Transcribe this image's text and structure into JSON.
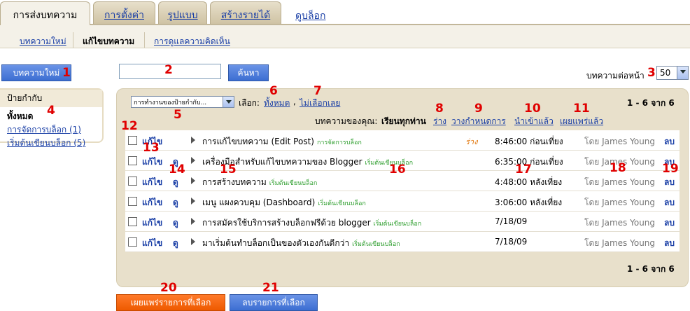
{
  "tabs": [
    {
      "label": "การส่งบทความ",
      "active": true
    },
    {
      "label": "การตั้งค่า",
      "active": false
    },
    {
      "label": "รูปแบบ",
      "active": false
    },
    {
      "label": "สร้างรายได้",
      "active": false
    },
    {
      "label": "ดูบล็อก",
      "active": false
    }
  ],
  "subtabs": [
    {
      "label": "บทความใหม่",
      "active": false
    },
    {
      "label": "แก้ไขบทความ",
      "active": true
    },
    {
      "label": "การดูแลความคิดเห็น",
      "active": false
    }
  ],
  "new_post_button": "บทความใหม่",
  "search": {
    "value": "",
    "button": "ค้นหา"
  },
  "per_page": {
    "label": "บทความต่อหน้า",
    "value": "50"
  },
  "labels_panel": {
    "header": "ป้ายกำกับ",
    "all": "ทั้งหมด",
    "items": [
      "การจัดการบล็อก (1)",
      "เริ่มต้นเขียนบล็อก (5)"
    ]
  },
  "toolbar": {
    "label_action": "การทำงานของป้ายกำกับ...",
    "select_prefix": "เลือก:",
    "select_all": "ทั้งหมด",
    "select_none": "ไม่เลือกเลย",
    "comma": ",",
    "range": "1 - 6 จาก 6",
    "filter_prefix": "บทความของคุณ:",
    "filter_all": "เรียนทุกท่าน",
    "filter_draft": "ร่าง",
    "filter_scheduled": "วางกำหนดการ",
    "filter_imported": "นำเข้าแล้ว",
    "filter_published": "เผยแพร่แล้ว"
  },
  "posts": [
    {
      "edit": "แก้ไข",
      "view": "",
      "title": "การแก้ไขบทความ (Edit Post)",
      "label": "การจัดการบล็อก",
      "status": "ร่าง",
      "time": "8:46:00 ก่อนเที่ยง",
      "author": "โดย James Young",
      "delete": "ลบ"
    },
    {
      "edit": "แก้ไข",
      "view": "ดู",
      "title": "เครื่องมือสำหรับแก้ไขบทความของ Blogger",
      "label": "เริ่มต้นเขียนบล็อก",
      "status": "",
      "time": "6:35:00 ก่อนเที่ยง",
      "author": "โดย James Young",
      "delete": "ลบ"
    },
    {
      "edit": "แก้ไข",
      "view": "ดู",
      "title": "การสร้างบทความ",
      "label": "เริ่มต้นเขียนบล็อก",
      "status": "",
      "time": "4:48:00 หลังเที่ยง",
      "author": "โดย James Young",
      "delete": "ลบ"
    },
    {
      "edit": "แก้ไข",
      "view": "ดู",
      "title": "เมนู แผงควบคุม (Dashboard)",
      "label": "เริ่มต้นเขียนบล็อก",
      "status": "",
      "time": "3:06:00 หลังเที่ยง",
      "author": "โดย James Young",
      "delete": "ลบ"
    },
    {
      "edit": "แก้ไข",
      "view": "ดู",
      "title": "การสมัครใช้บริการสร้างบล็อกฟรีด้วย blogger",
      "label": "เริ่มต้นเขียนบล็อก",
      "status": "",
      "time": "7/18/09",
      "author": "โดย James Young",
      "delete": "ลบ"
    },
    {
      "edit": "แก้ไข",
      "view": "ดู",
      "title": "มาเริ่มต้นทำบล็อกเป็นของตัวเองกันดีกว่า",
      "label": "เริ่มต้นเขียนบล็อก",
      "status": "",
      "time": "7/18/09",
      "author": "โดย James Young",
      "delete": "ลบ"
    }
  ],
  "bottom_range": "1 - 6 จาก 6",
  "publish_selected": "เผยแพร่รายการที่เลือก",
  "delete_selected": "ลบรายการที่เลือก",
  "annotations": [
    "1",
    "2",
    "3",
    "4",
    "5",
    "6",
    "7",
    "8",
    "9",
    "10",
    "11",
    "12",
    "13",
    "14",
    "15",
    "16",
    "17",
    "18",
    "19",
    "20",
    "21"
  ],
  "colors": {
    "accent_blue": "#3c6ed2",
    "publish_orange": "#ee5a00",
    "annotation_red": "#e00000",
    "panel_bg": "#e8e0cb"
  }
}
